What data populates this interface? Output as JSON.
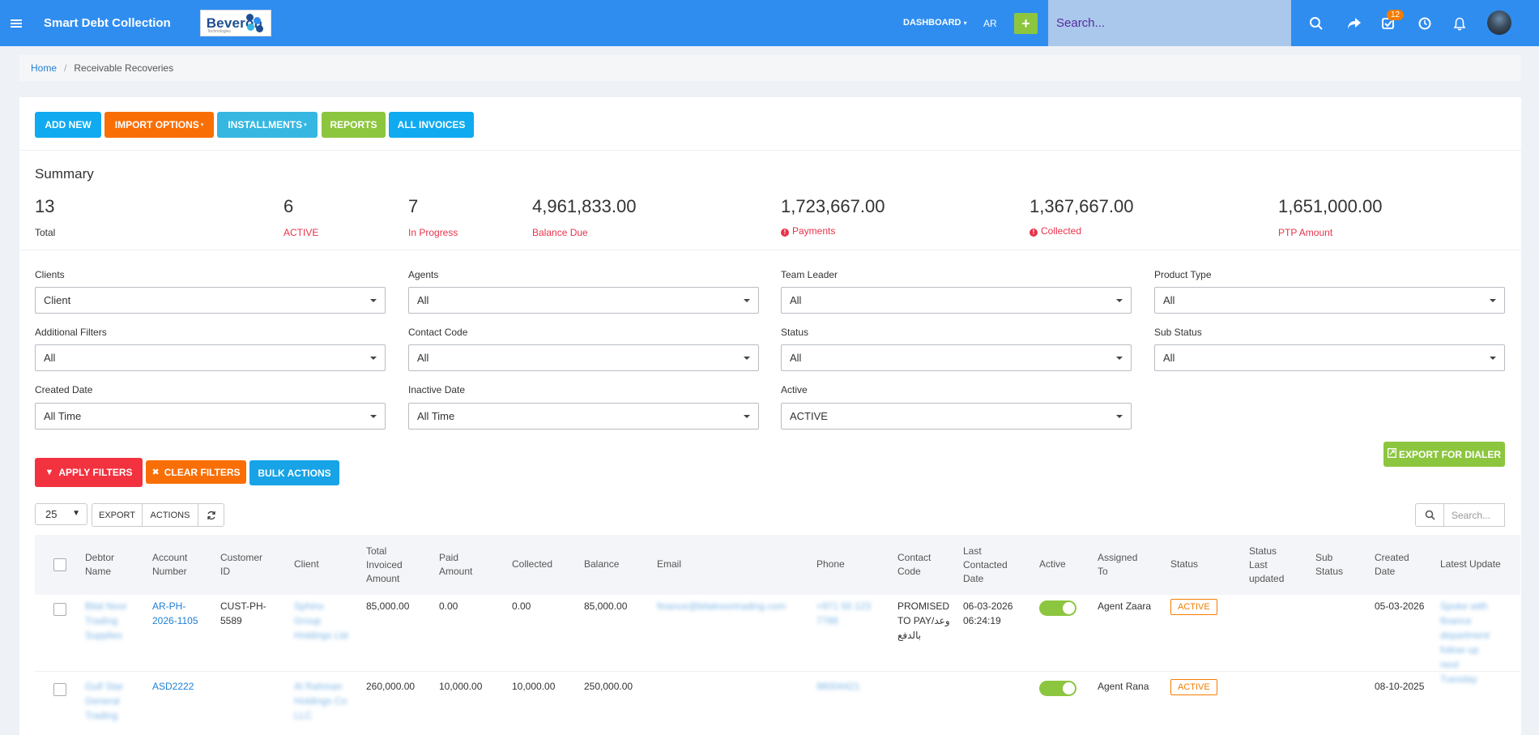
{
  "app": {
    "title": "Smart Debt Collection",
    "logo_text": "Beveron",
    "logo_sub": "Technologies"
  },
  "nav": {
    "dashboard": "DASHBOARD",
    "lang": "AR",
    "add": "+",
    "search_placeholder": "Search...",
    "notifications_count": "12"
  },
  "breadcrumb": {
    "home": "Home",
    "separator": "/",
    "current": "Receivable Recoveries"
  },
  "actions": {
    "add_new": "ADD NEW",
    "import_options": "IMPORT OPTIONS",
    "installments": "INSTALLMENTS",
    "reports": "REPORTS",
    "all_invoices": "ALL INVOICES"
  },
  "summary": {
    "title": "Summary",
    "stats": [
      {
        "value": "13",
        "label": "Total"
      },
      {
        "value": "6",
        "label": "ACTIVE"
      },
      {
        "value": "7",
        "label": "In Progress"
      },
      {
        "value": "4,961,833.00",
        "label": "Balance Due"
      },
      {
        "value": "1,723,667.00",
        "label": "Payments"
      },
      {
        "value": "1,367,667.00",
        "label": "Collected"
      },
      {
        "value": "1,651,000.00",
        "label": "PTP Amount"
      }
    ]
  },
  "filters": [
    {
      "label": "Clients",
      "value": "Client"
    },
    {
      "label": "Agents",
      "value": "All"
    },
    {
      "label": "Team Leader",
      "value": "All"
    },
    {
      "label": "Product Type",
      "value": "All"
    },
    {
      "label": "Additional Filters",
      "value": "All"
    },
    {
      "label": "Contact Code",
      "value": "All"
    },
    {
      "label": "Status",
      "value": "All"
    },
    {
      "label": "Sub Status",
      "value": "All"
    },
    {
      "label": "Created Date",
      "value": "All Time"
    },
    {
      "label": "Inactive Date",
      "value": "All Time"
    },
    {
      "label": "Active",
      "value": "ACTIVE"
    }
  ],
  "filter_buttons": {
    "apply": "APPLY FILTERS",
    "clear": "CLEAR FILTERS",
    "bulk": "BULK ACTIONS",
    "export_dialer": "EXPORT FOR DIALER"
  },
  "table_tools": {
    "page_size": "25",
    "export": "EXPORT",
    "actions": "ACTIONS",
    "search_placeholder": "Search..."
  },
  "table": {
    "headers": {
      "debtor_name": [
        "Debtor",
        "Name"
      ],
      "account_number": [
        "Account",
        "Number"
      ],
      "customer_id": [
        "Customer",
        "ID"
      ],
      "client": [
        "Client"
      ],
      "total_invoiced": [
        "Total",
        "Invoiced",
        "Amount"
      ],
      "paid_amount": [
        "Paid",
        "Amount"
      ],
      "collected": [
        "Collected"
      ],
      "balance": [
        "Balance"
      ],
      "email": [
        "Email"
      ],
      "phone": [
        "Phone"
      ],
      "contact_code": [
        "Contact",
        "Code"
      ],
      "last_contacted": [
        "Last",
        "Contacted",
        "Date"
      ],
      "active": [
        "Active"
      ],
      "assigned_to": [
        "Assigned",
        "To"
      ],
      "status": [
        "Status"
      ],
      "status_last_updated": [
        "Status",
        "Last",
        "updated"
      ],
      "sub_status": [
        "Sub",
        "Status"
      ],
      "created_date": [
        "Created",
        "Date"
      ],
      "latest_update": [
        "Latest Update"
      ]
    },
    "rows": [
      {
        "debtor_name": [
          "Bilal Noor",
          "Trading",
          "Supplies"
        ],
        "account_number": [
          "AR-PH-",
          "2026-1105"
        ],
        "customer_id": [
          "CUST-PH-",
          "5589"
        ],
        "client": [
          "Sphinx",
          "Group",
          "Holdings Ltd"
        ],
        "total_invoiced": "85,000.00",
        "paid_amount": "0.00",
        "collected": "0.00",
        "balance": "85,000.00",
        "email": "finance@bilalnoortrading.com",
        "phone": "+971 50 123 7788",
        "contact_code": [
          "PROMISED",
          "TO PAY/وعد",
          "بالدفع"
        ],
        "last_contacted": [
          "06-03-2026",
          "06:24:19"
        ],
        "active": true,
        "assigned_to": "Agent Zaara",
        "status": "ACTIVE",
        "status_last_updated": "",
        "sub_status": "",
        "created_date": "05-03-2026",
        "latest_update": [
          "Spoke with",
          "finance",
          "department",
          "follow up",
          "next",
          "Tuesday"
        ]
      },
      {
        "debtor_name": [
          "Gulf Star",
          "General",
          "Trading"
        ],
        "account_number": [
          "ASD2222"
        ],
        "customer_id": [],
        "client": [
          "Al Rahman",
          "Holdings Co",
          "LLC"
        ],
        "total_invoiced": "260,000.00",
        "paid_amount": "10,000.00",
        "collected": "10,000.00",
        "balance": "250,000.00",
        "email": "",
        "phone": "98004421",
        "contact_code": [],
        "last_contacted": [],
        "active": true,
        "assigned_to": "Agent Rana",
        "status": "ACTIVE",
        "status_last_updated": "",
        "sub_status": "",
        "created_date": "08-10-2025",
        "latest_update": []
      }
    ]
  }
}
